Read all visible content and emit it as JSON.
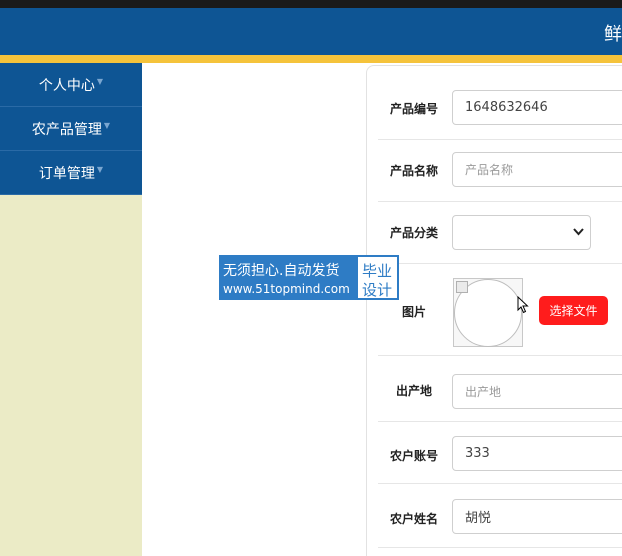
{
  "header": {
    "brand": "鲜"
  },
  "sidebar": {
    "items": [
      {
        "label": "个人中心",
        "caret": "▼"
      },
      {
        "label": "农产品管理",
        "caret": "▼"
      },
      {
        "label": "订单管理",
        "caret": "▼"
      }
    ]
  },
  "form": {
    "product_code": {
      "label": "产品编号",
      "value": "1648632646"
    },
    "product_name": {
      "label": "产品名称",
      "placeholder": "产品名称"
    },
    "product_category": {
      "label": "产品分类",
      "value": ""
    },
    "image": {
      "label": "图片",
      "button": "选择文件"
    },
    "origin": {
      "label": "出产地",
      "placeholder": "出产地"
    },
    "farmer_account": {
      "label": "农户账号",
      "value": "333"
    },
    "farmer_name": {
      "label": "农户姓名",
      "value": "胡悦"
    }
  },
  "watermark": {
    "line1": "无须担心.自动发货",
    "line2": "www.51topmind.com",
    "tag_line1": "毕业",
    "tag_line2": "设计"
  },
  "colors": {
    "header_bg": "#0e5594",
    "accent_stripe": "#f5c33b",
    "sidebar_bg": "#ebebc6",
    "primary_button": "#ff1c1c"
  }
}
